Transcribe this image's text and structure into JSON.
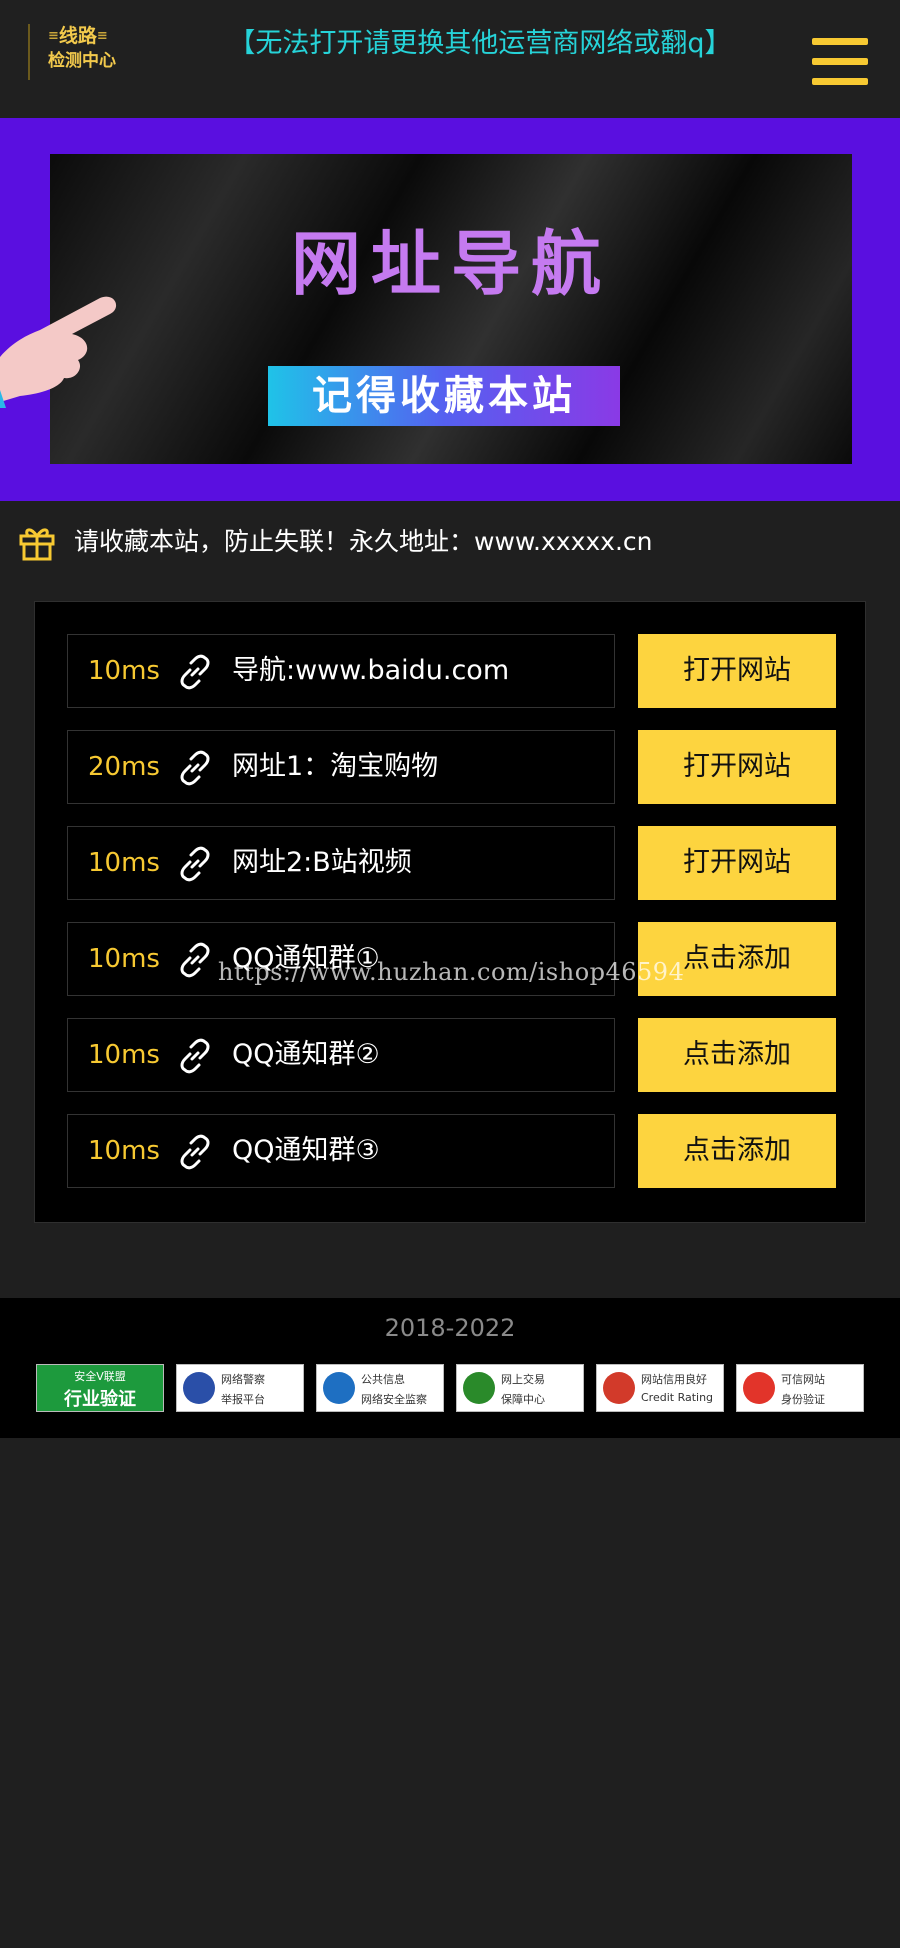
{
  "header": {
    "logo_line1": "线路",
    "logo_line2": "检测中心",
    "notice": "【无法打开请更换其他运营商网络或翻q】",
    "menu_icon": "hamburger-menu-icon"
  },
  "banner": {
    "title": "网址导航",
    "subtitle": "记得收藏本站"
  },
  "tip": {
    "icon": "gift-icon",
    "text": "请收藏本站，防止失联！永久地址：www.xxxxx.cn"
  },
  "rows": [
    {
      "ms": "10ms",
      "label": "导航:www.baidu.com",
      "button": "打开网站"
    },
    {
      "ms": "20ms",
      "label": "网址1：淘宝购物",
      "button": "打开网站"
    },
    {
      "ms": "10ms",
      "label": "网址2:B站视频",
      "button": "打开网站"
    },
    {
      "ms": "10ms",
      "label": "QQ通知群①",
      "button": "点击添加"
    },
    {
      "ms": "10ms",
      "label": "QQ通知群②",
      "button": "点击添加"
    },
    {
      "ms": "10ms",
      "label": "QQ通知群③",
      "button": "点击添加"
    }
  ],
  "watermark": "https://www.huzhan.com/ishop46594",
  "footer": {
    "copyright": "2018-2022",
    "badges": [
      {
        "line1": "安全V联盟",
        "line2": "行业验证"
      },
      {
        "line1": "网络警察",
        "line2": "举报平台"
      },
      {
        "line1": "公共信息",
        "line2": "网络安全监察"
      },
      {
        "line1": "网上交易",
        "line2": "保障中心"
      },
      {
        "line1": "网站信用良好",
        "line2": "Credit Rating"
      },
      {
        "line1": "可信网站",
        "line2": "身份验证"
      }
    ]
  },
  "colors": {
    "accent": "#fdd43f",
    "notice": "#26d3d8",
    "banner_bg": "#5a0fe0",
    "page_bg": "#1f1f1f"
  }
}
